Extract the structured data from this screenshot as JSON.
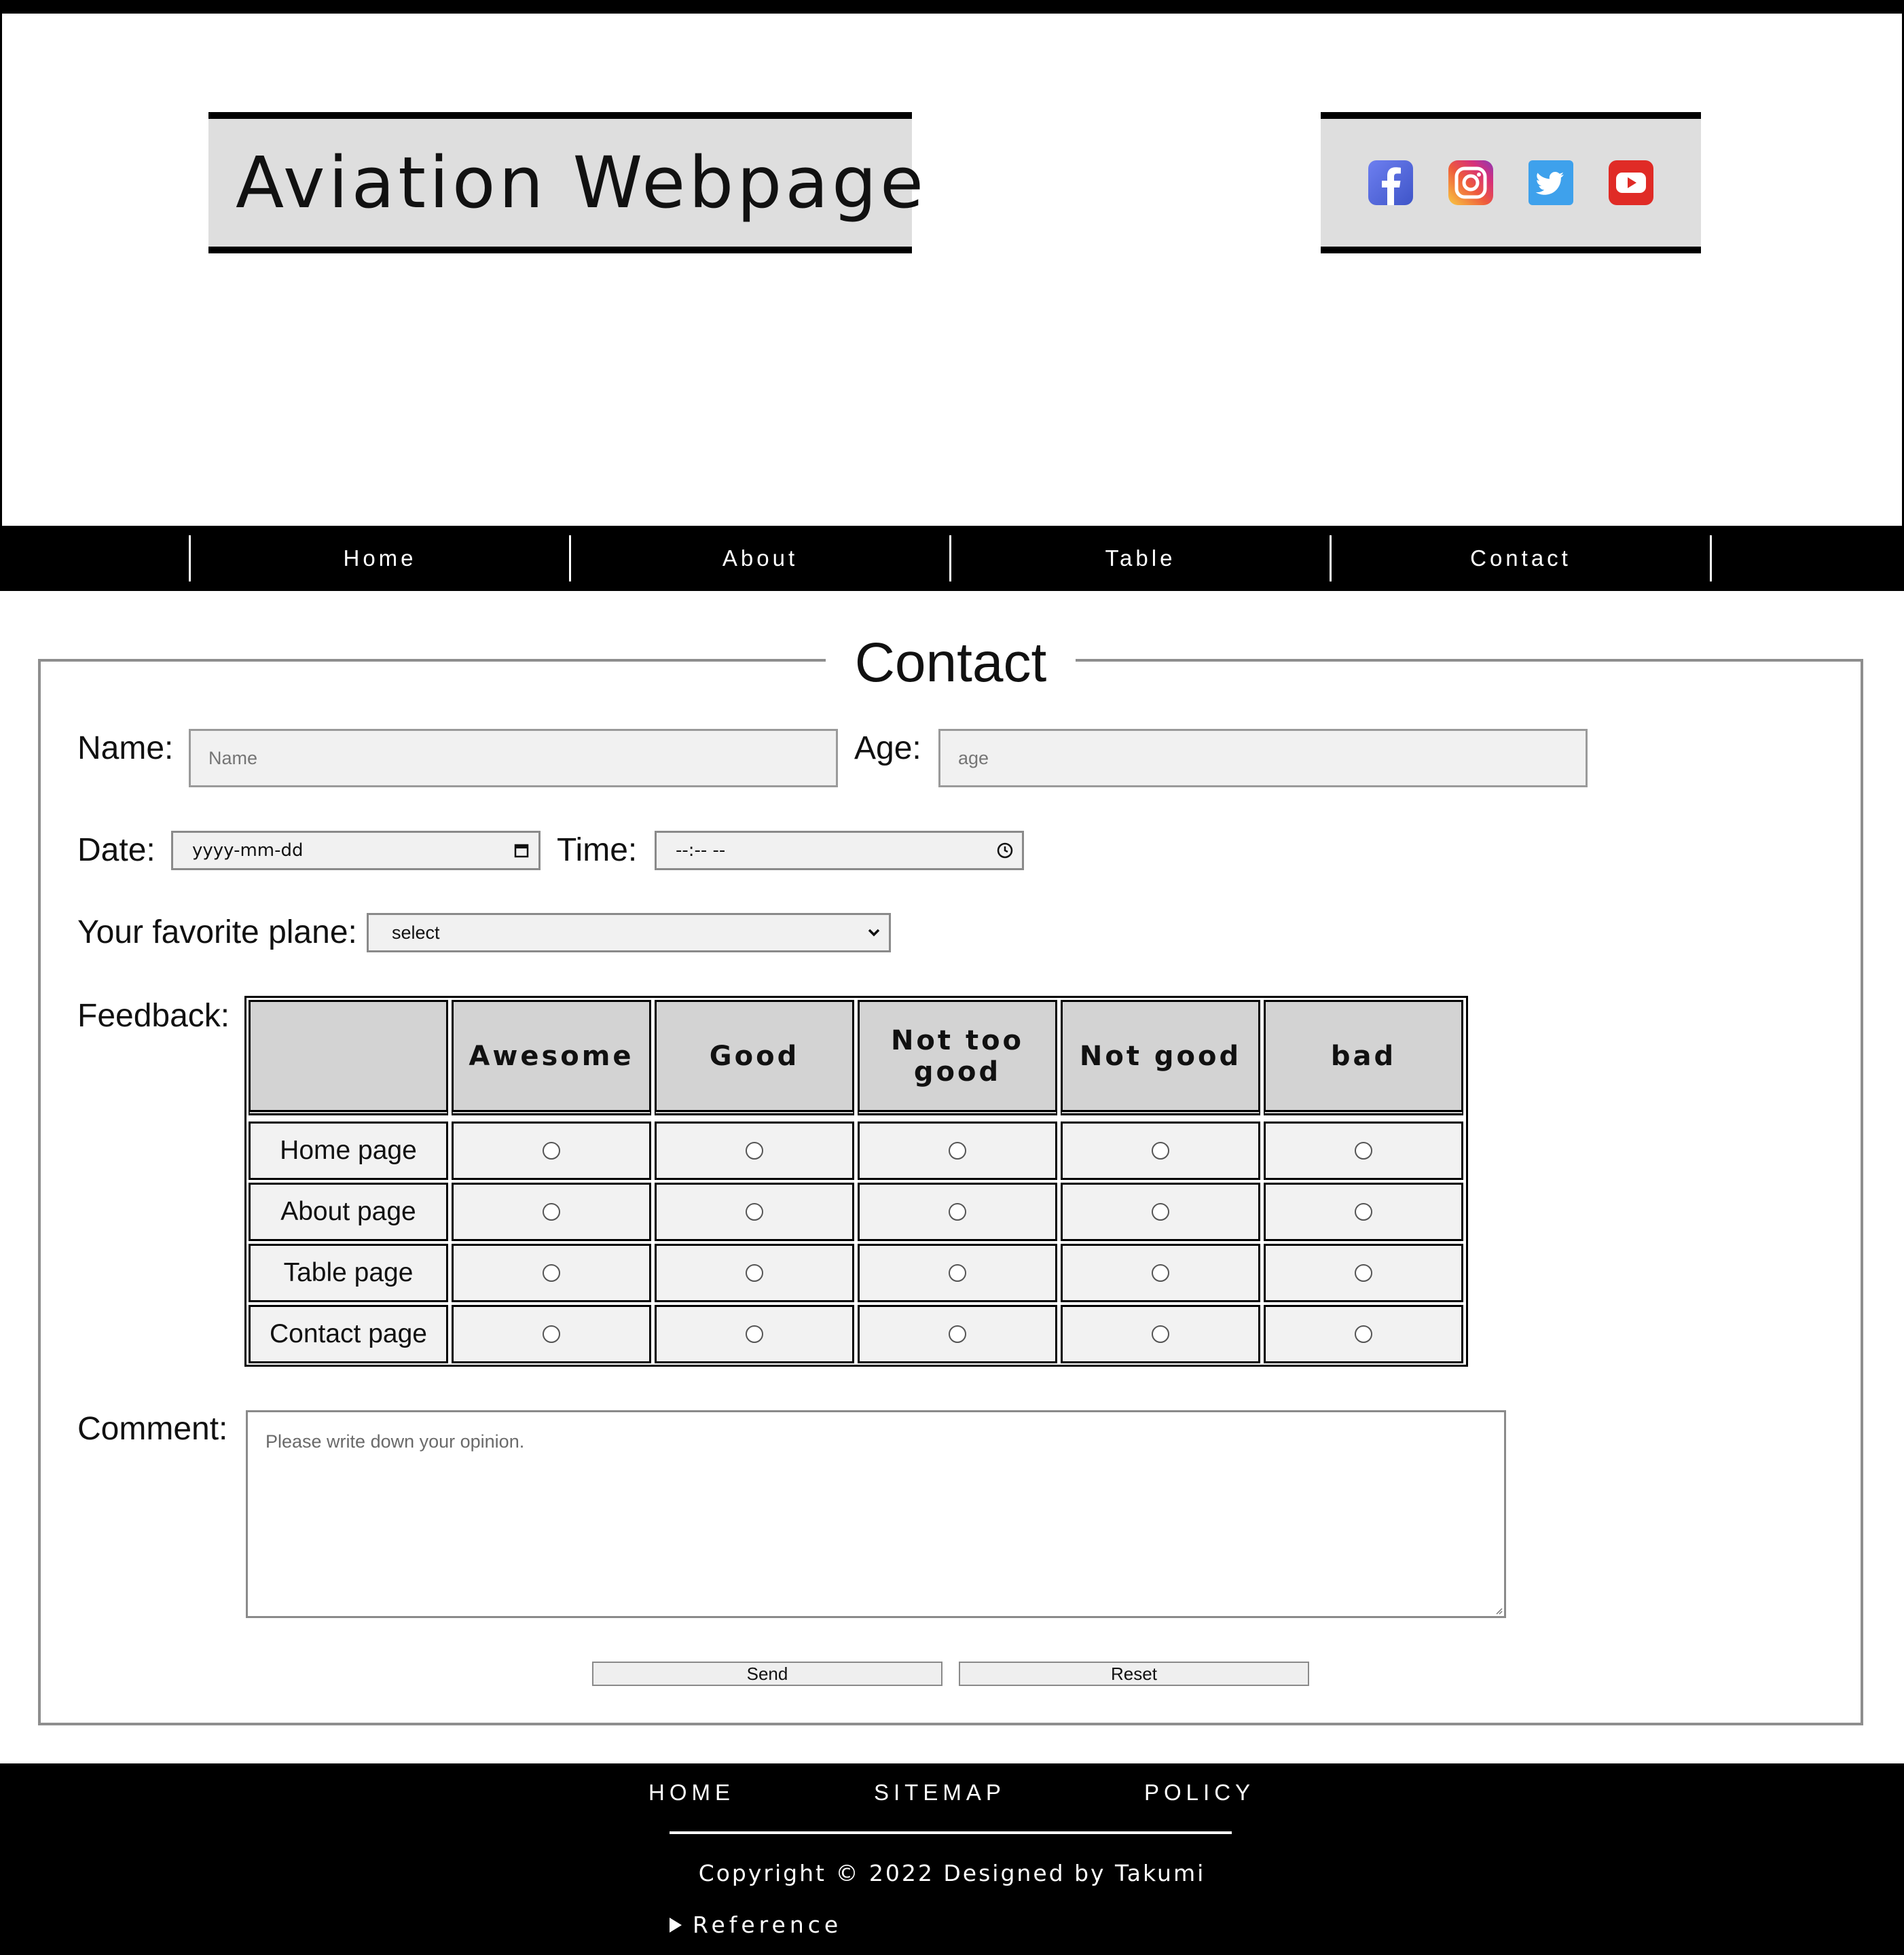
{
  "header": {
    "title": "Aviation Webpage",
    "social": [
      {
        "icon": "facebook-icon",
        "color": "#5468d8"
      },
      {
        "icon": "instagram-icon",
        "color": "#d62f7a"
      },
      {
        "icon": "twitter-icon",
        "color": "#3ea1ec"
      },
      {
        "icon": "youtube-icon",
        "color": "#e02b26"
      }
    ]
  },
  "nav": {
    "items": [
      "Home",
      "About",
      "Table",
      "Contact"
    ]
  },
  "contact": {
    "legend": "Contact",
    "name_label": "Name:",
    "name_placeholder": "Name",
    "age_label": "Age:",
    "age_placeholder": "age",
    "date_label": "Date:",
    "date_value": "yyyy-mm-dd",
    "time_label": "Time:",
    "time_value": "--:-- --",
    "plane_label": "Your favorite plane:",
    "plane_selected": "select",
    "feedback_label": "Feedback:",
    "feedback": {
      "columns": [
        "",
        "Awesome",
        "Good",
        "Not too good",
        "Not good",
        "bad"
      ],
      "rows": [
        "Home page",
        "About page",
        "Table page",
        "Contact page"
      ]
    },
    "comment_label": "Comment:",
    "comment_placeholder": "Please write down your opinion.",
    "send_label": "Send",
    "reset_label": "Reset"
  },
  "footer": {
    "links": [
      "HOME",
      "SITEMAP",
      "POLICY"
    ],
    "copyright": "Copyright © 2022 Designed by Takumi",
    "reference": "Reference"
  }
}
